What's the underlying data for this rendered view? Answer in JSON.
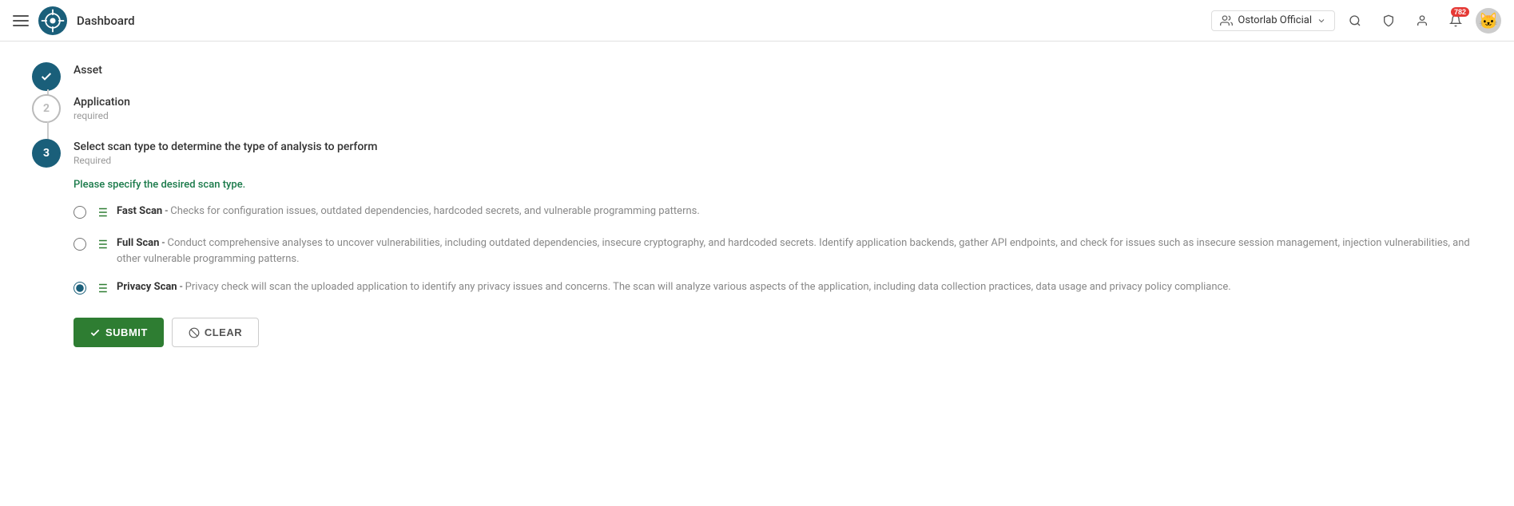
{
  "header": {
    "menu_icon": "hamburger-icon",
    "logo_alt": "Ostorlab logo",
    "title": "Dashboard",
    "org_selector": {
      "label": "Ostorlab Official",
      "dropdown_icon": "chevron-down-icon"
    },
    "search_icon": "search-icon",
    "shield_icon": "shield-icon",
    "person_icon": "person-icon",
    "notification_icon": "bell-icon",
    "notification_count": "782",
    "avatar_emoji": "🐱"
  },
  "stepper": {
    "steps": [
      {
        "number": "✓",
        "state": "completed",
        "title": "Asset",
        "subtitle": ""
      },
      {
        "number": "2",
        "state": "pending",
        "title": "Application",
        "subtitle": "required"
      },
      {
        "number": "3",
        "state": "active",
        "title": "Select scan type to determine the type of analysis to perform",
        "subtitle": "Required"
      }
    ]
  },
  "scan_section": {
    "prompt": "Please specify the desired scan type.",
    "options": [
      {
        "id": "fast",
        "label": "Fast Scan",
        "description": "Checks for configuration issues, outdated dependencies, hardcoded secrets, and vulnerable programming patterns.",
        "selected": false
      },
      {
        "id": "full",
        "label": "Full Scan",
        "description": "Conduct comprehensive analyses to uncover vulnerabilities, including outdated dependencies, insecure cryptography, and hardcoded secrets. Identify application backends, gather API endpoints, and check for issues such as insecure session management, injection vulnerabilities, and other vulnerable programming patterns.",
        "selected": false
      },
      {
        "id": "privacy",
        "label": "Privacy Scan",
        "description": "Privacy check will scan the uploaded application to identify any privacy issues and concerns. The scan will analyze various aspects of the application, including data collection practices, data usage and privacy policy compliance.",
        "selected": true
      }
    ]
  },
  "buttons": {
    "submit_label": "SUBMIT",
    "clear_label": "CLEAR"
  }
}
